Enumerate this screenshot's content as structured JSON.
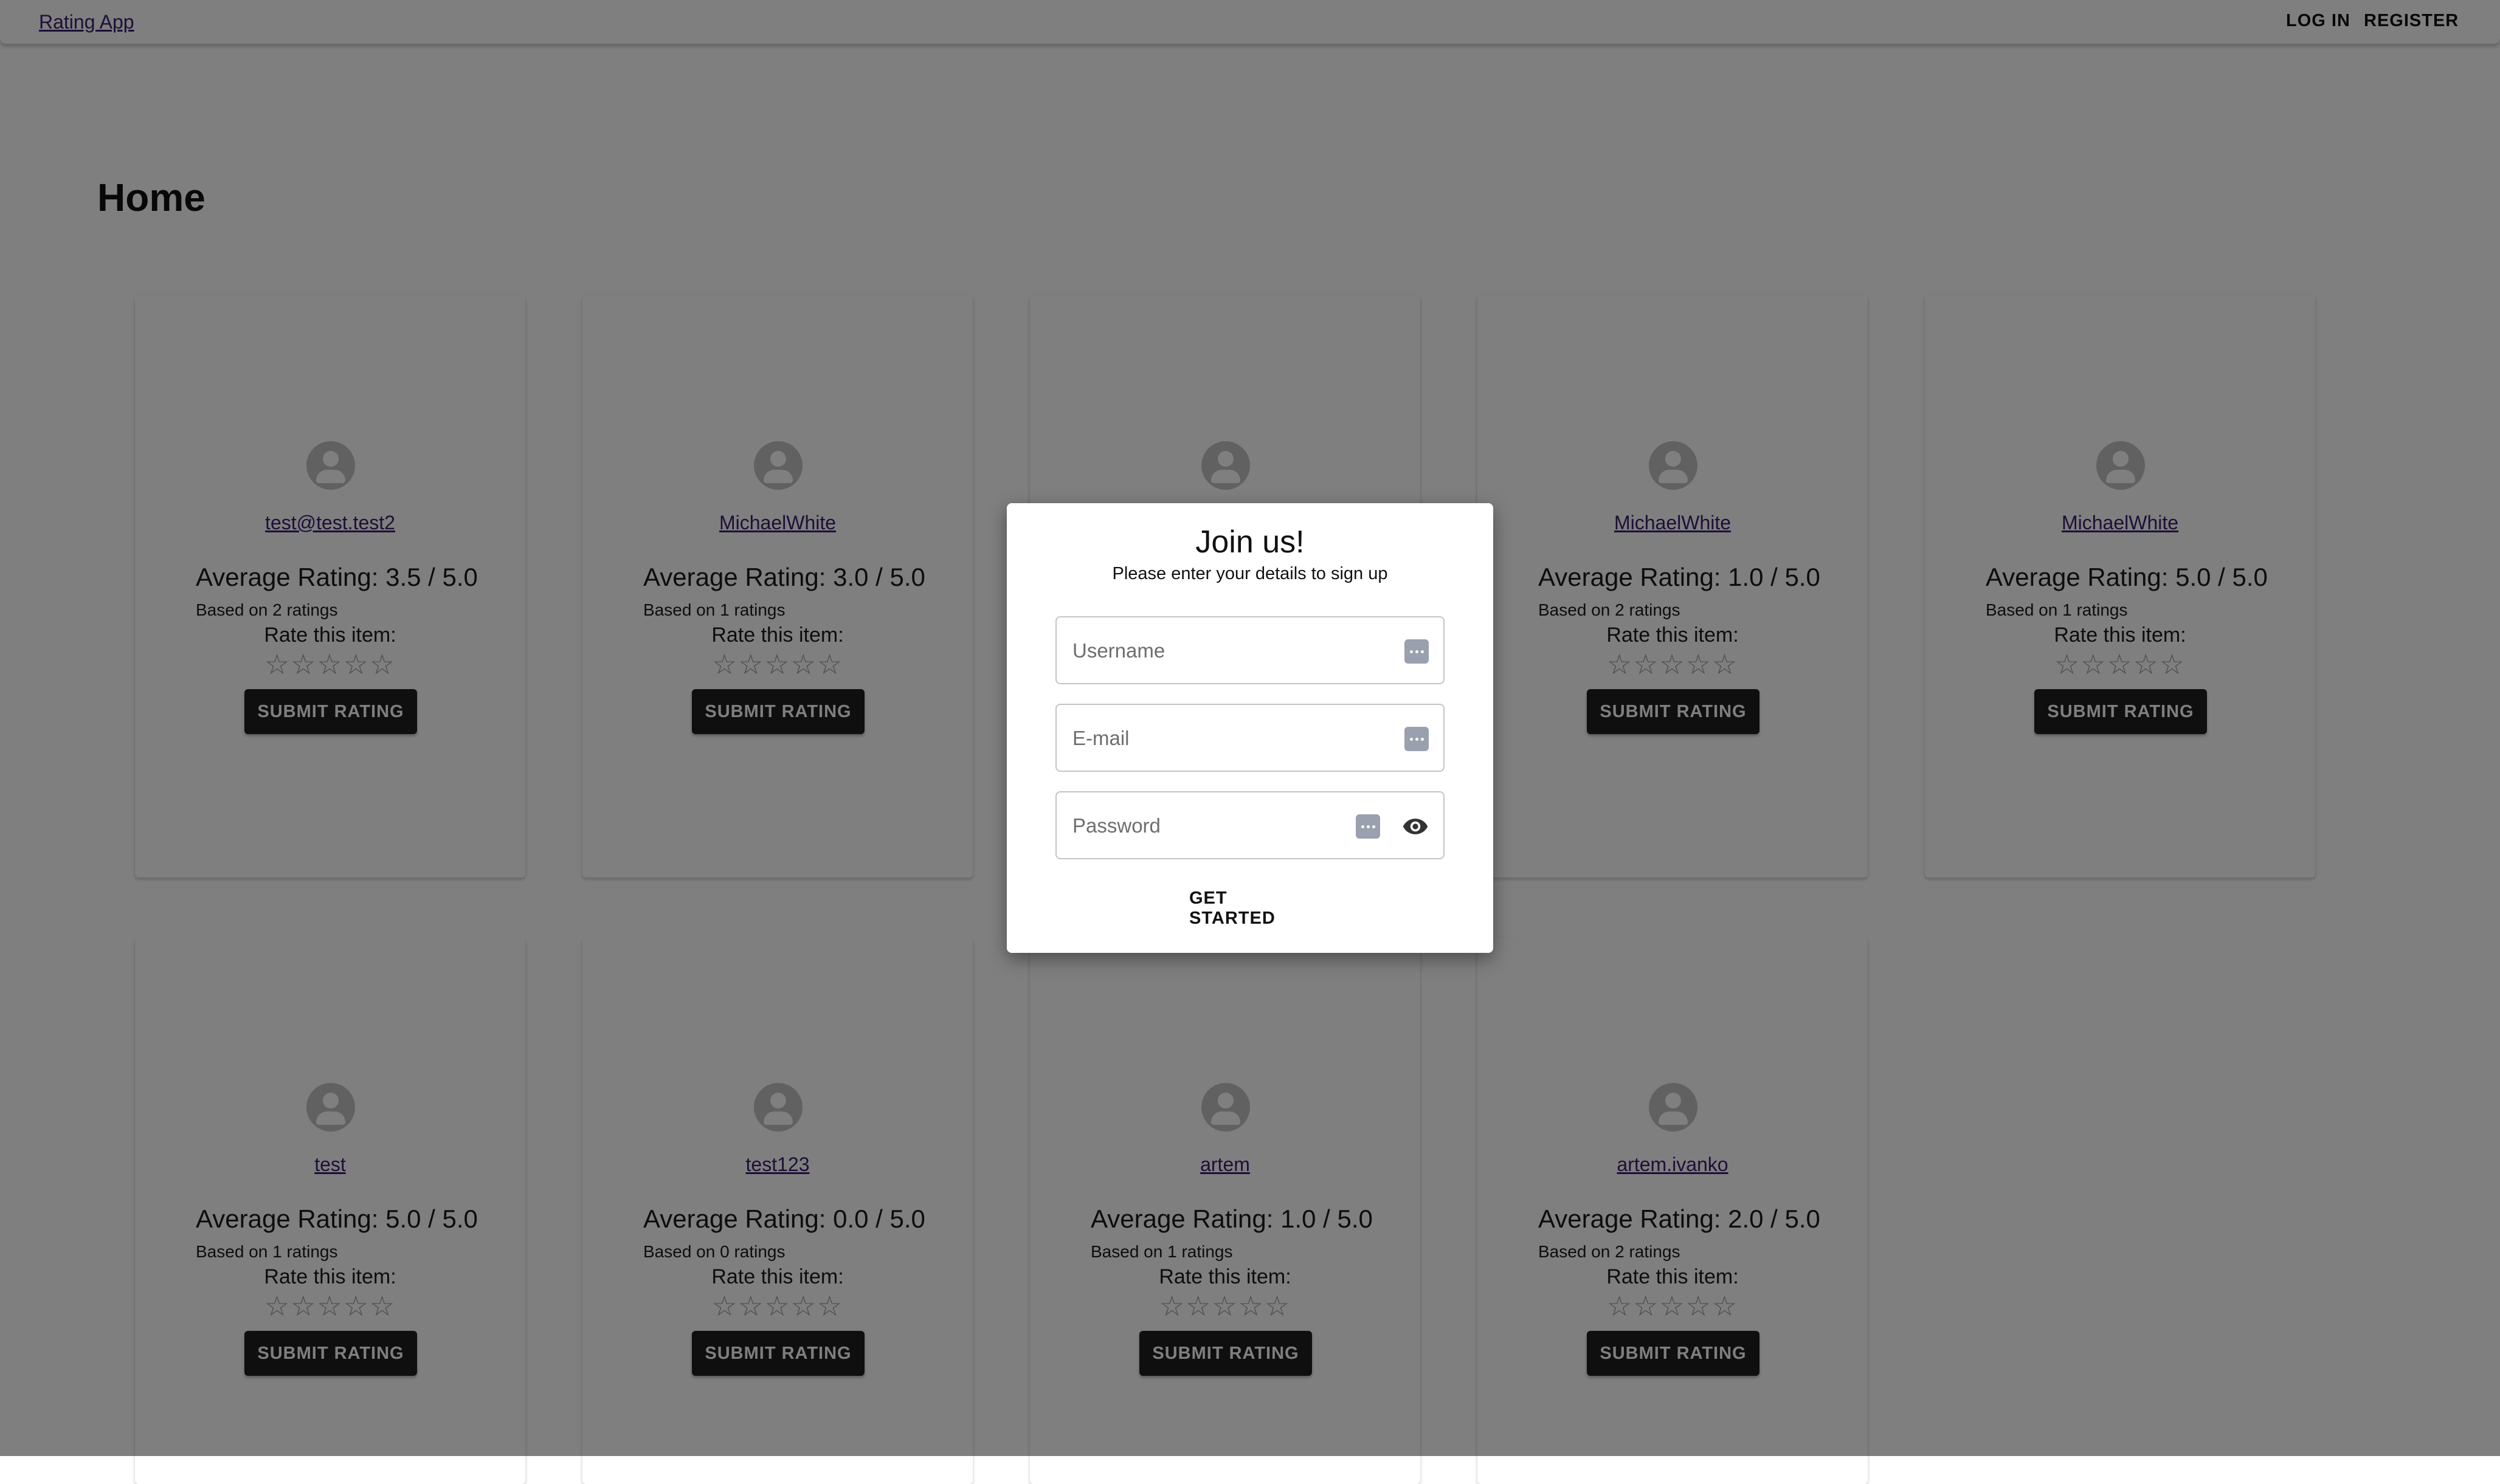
{
  "header": {
    "brand": "Rating App",
    "login_label": "LOG IN",
    "register_label": "REGISTER"
  },
  "page": {
    "title": "Home"
  },
  "cards": [
    {
      "user": "test@test.test2",
      "average": "Average Rating: 3.5 / 5.0",
      "based_on": "Based on 2 ratings",
      "rate_label": "Rate this item:",
      "submit_label": "SUBMIT RATING"
    },
    {
      "user": "MichaelWhite",
      "average": "Average Rating: 3.0 / 5.0",
      "based_on": "Based on 1 ratings",
      "rate_label": "Rate this item:",
      "submit_label": "SUBMIT RATING"
    },
    {
      "user": "",
      "average": "",
      "based_on": "",
      "rate_label": "",
      "submit_label": ""
    },
    {
      "user": "MichaelWhite",
      "average": "Average Rating: 1.0 / 5.0",
      "based_on": "Based on 2 ratings",
      "rate_label": "Rate this item:",
      "submit_label": "SUBMIT RATING"
    },
    {
      "user": "MichaelWhite",
      "average": "Average Rating: 5.0 / 5.0",
      "based_on": "Based on 1 ratings",
      "rate_label": "Rate this item:",
      "submit_label": "SUBMIT RATING"
    },
    {
      "user": "test",
      "average": "Average Rating: 5.0 / 5.0",
      "based_on": "Based on 1 ratings",
      "rate_label": "Rate this item:",
      "submit_label": "SUBMIT RATING"
    },
    {
      "user": "test123",
      "average": "Average Rating: 0.0 / 5.0",
      "based_on": "Based on 0 ratings",
      "rate_label": "Rate this item:",
      "submit_label": "SUBMIT RATING"
    },
    {
      "user": "artem",
      "average": "Average Rating: 1.0 / 5.0",
      "based_on": "Based on 1 ratings",
      "rate_label": "Rate this item:",
      "submit_label": "SUBMIT RATING"
    },
    {
      "user": "artem.ivanko",
      "average": "Average Rating: 2.0 / 5.0",
      "based_on": "Based on 2 ratings",
      "rate_label": "Rate this item:",
      "submit_label": "SUBMIT RATING"
    }
  ],
  "star_glyph": "☆",
  "modal": {
    "title": "Join us!",
    "subtitle": "Please enter your details to sign up",
    "username_placeholder": "Username",
    "email_placeholder": "E-mail",
    "password_placeholder": "Password",
    "submit_label": "GET STARTED"
  },
  "colors": {
    "accent_link": "#3b1f6e",
    "button_dark": "#1f1f1f",
    "overlay": "rgba(0,0,0,0.5)"
  }
}
